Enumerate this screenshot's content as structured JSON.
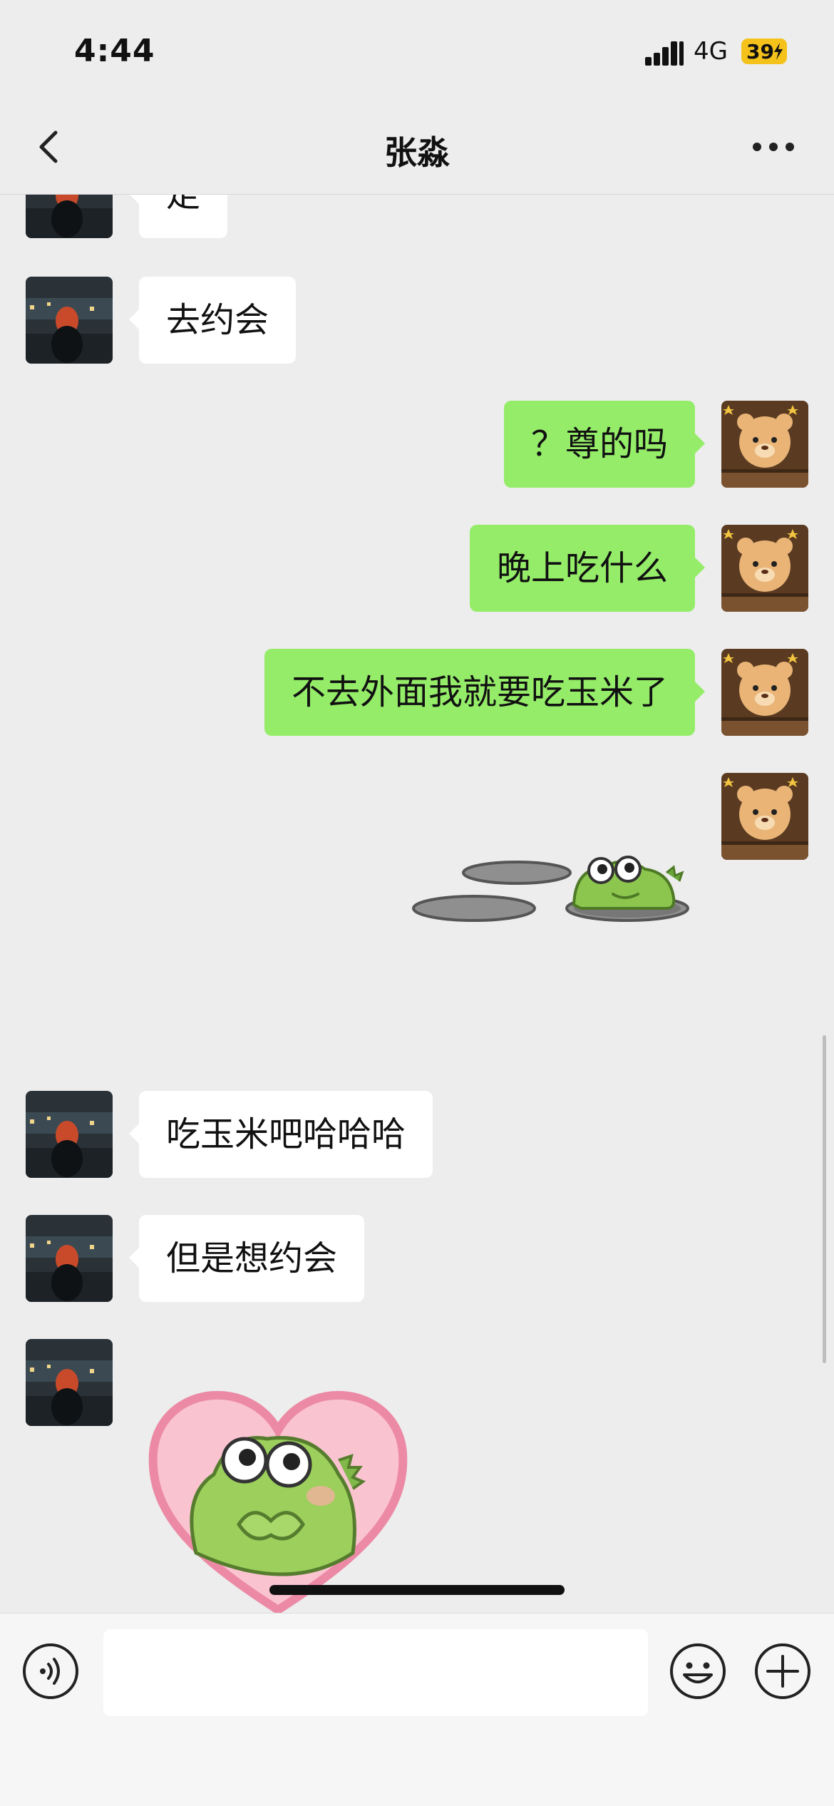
{
  "status": {
    "time": "4:44",
    "network": "4G",
    "battery": "39"
  },
  "header": {
    "title": "张淼"
  },
  "messages": [
    {
      "side": "left",
      "text": "走"
    },
    {
      "side": "left",
      "text": "去约会"
    },
    {
      "side": "right",
      "text": "？尊的吗"
    },
    {
      "side": "right",
      "text": "晚上吃什么"
    },
    {
      "side": "right",
      "text": "不去外面我就要吃玉米了"
    },
    {
      "side": "right",
      "sticker": "frog-peeking-from-manhole-sticker"
    },
    {
      "side": "left",
      "text": "吃玉米吧哈哈哈"
    },
    {
      "side": "left",
      "text": "但是想约会"
    },
    {
      "side": "left",
      "sticker": "frog-in-pink-heart-sticker"
    }
  ],
  "icons": {
    "back": "chevron-left-icon",
    "more": "more-dots-icon",
    "voice": "voice-input-icon",
    "emoji": "emoji-icon",
    "plus": "plus-icon"
  },
  "colors": {
    "sent_bubble": "#95ec69",
    "received_bubble": "#ffffff",
    "background": "#ededed"
  }
}
